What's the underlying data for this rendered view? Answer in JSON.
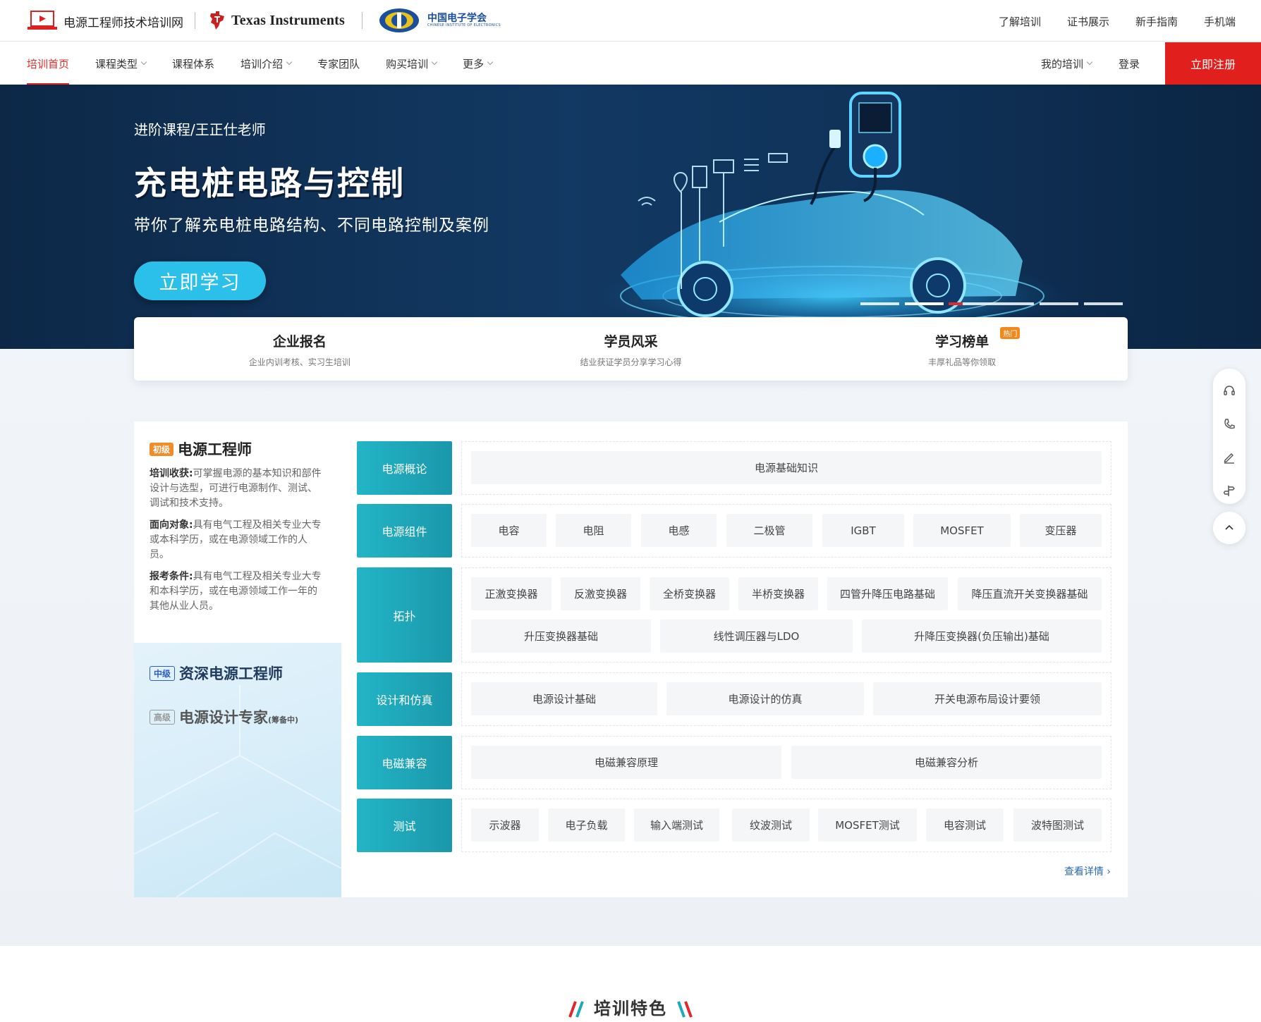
{
  "header": {
    "site_name": "电源工程师技术培训网",
    "ti_logo_text": "Texas Instruments",
    "cie_logo_text": "中国电子学会",
    "cie_logo_sub": "CHINESE INSTITUTE OF ELECTRONICS",
    "top_links": [
      "了解培训",
      "证书展示",
      "新手指南",
      "手机端"
    ]
  },
  "nav": {
    "items": [
      {
        "label": "培训首页",
        "active": true,
        "dropdown": false
      },
      {
        "label": "课程类型",
        "active": false,
        "dropdown": true
      },
      {
        "label": "课程体系",
        "active": false,
        "dropdown": false
      },
      {
        "label": "培训介绍",
        "active": false,
        "dropdown": true
      },
      {
        "label": "专家团队",
        "active": false,
        "dropdown": false
      },
      {
        "label": "购买培训",
        "active": false,
        "dropdown": true
      },
      {
        "label": "更多",
        "active": false,
        "dropdown": true
      }
    ],
    "my_training": "我的培训",
    "login": "登录",
    "register": "立即注册"
  },
  "banner": {
    "subtitle": "进阶课程/王正仕老师",
    "title": "充电桩电路与控制",
    "description": "带你了解充电桩电路结构、不同电路控制及案例",
    "button": "立即学习",
    "slide_count": 5,
    "active_slide": 1
  },
  "quick_links": [
    {
      "title": "企业报名",
      "desc": "企业内训考核、实习生培训",
      "badge": ""
    },
    {
      "title": "学员风采",
      "desc": "结业获证学员分享学习心得",
      "badge": ""
    },
    {
      "title": "学习榜单",
      "desc": "丰厚礼品等你领取",
      "badge": "热门"
    }
  ],
  "course_panel": {
    "basic": {
      "tag": "初级",
      "title": "电源工程师",
      "gain_label": "培训收获:",
      "gain_text": "可掌握电源的基本知识和部件设计与选型，可进行电源制作、测试、调试和技术支持。",
      "target_label": "面向对象:",
      "target_text": "具有电气工程及相关专业大专或本科学历，或在电源领域工作的人员。",
      "req_label": "报考条件:",
      "req_text": "具有电气工程及相关专业大专和本科学历，或在电源领域工作一年的其他从业人员。"
    },
    "mid": {
      "tag": "中级",
      "title": "资深电源工程师"
    },
    "high": {
      "tag": "高级",
      "title": "电源设计专家",
      "note": "(筹备中)"
    },
    "categories": [
      {
        "name": "电源概论",
        "items": [
          "电源基础知识"
        ]
      },
      {
        "name": "电源组件",
        "items": [
          "电容",
          "电阻",
          "电感",
          "二极管",
          "IGBT",
          "MOSFET",
          "变压器"
        ]
      },
      {
        "name": "拓扑",
        "items": [
          "正激变换器",
          "反激变换器",
          "全桥变换器",
          "半桥变换器",
          "四管升降压电路基础",
          "降压直流开关变换器基础",
          "升压变换器基础",
          "线性调压器与LDO",
          "升降压变换器(负压输出)基础"
        ]
      },
      {
        "name": "设计和仿真",
        "items": [
          "电源设计基础",
          "电源设计的仿真",
          "开关电源布局设计要领"
        ]
      },
      {
        "name": "电磁兼容",
        "items": [
          "电磁兼容原理",
          "电磁兼容分析"
        ]
      },
      {
        "name": "测试",
        "items": [
          "示波器",
          "电子负载",
          "输入端测试",
          "纹波测试",
          "MOSFET测试",
          "电容测试",
          "波特图测试"
        ]
      }
    ],
    "more": "查看详情 ›"
  },
  "section": {
    "title": "培训特色"
  },
  "colors": {
    "brand_red": "#e1201e",
    "accent_cyan": "#2bc0ea",
    "category_teal": "#1fa9bb",
    "link_blue": "#2b6ab0"
  }
}
